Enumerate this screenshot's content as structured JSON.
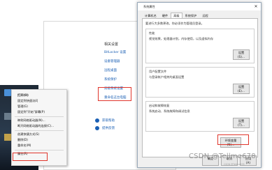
{
  "control_panel": {
    "header": "相关设置",
    "links": [
      "BitLocker 设置",
      "设备管理器",
      "远程桌面",
      "系统保护",
      "高级系统设置",
      "重命名这台电脑"
    ],
    "help": [
      "获取帮助",
      "提供反馈"
    ]
  },
  "context_menu": {
    "items": [
      "打开(O)",
      "固定到快速访问",
      "管理(G)",
      "固定到\"开始\"屏幕(P)",
      "映射网络驱动器(N)...",
      "断开网络驱动器的连接(C)...",
      "创建快捷方式(S)",
      "删除(D)",
      "重命名(M)",
      "属性(R)"
    ]
  },
  "dialog": {
    "title": "系统属性",
    "close": "✕",
    "tabs": [
      "计算机名",
      "硬件",
      "高级",
      "系统保护",
      "远程"
    ],
    "active_tab": "高级",
    "note": "要进行大多数更改，你必须作为管理员登录。",
    "groups": [
      {
        "title": "性能",
        "desc": "视觉效果，处理器计划，内存使用，以及虚拟内存",
        "button": "设置(S)..."
      },
      {
        "title": "用户配置文件",
        "desc": "与登录帐户相关的桌面设置",
        "button": "设置(E)..."
      },
      {
        "title": "启动和故障恢复",
        "desc": "系统启动、系统故障和调试信息",
        "button": "设置(T)..."
      }
    ],
    "env_button": "环境变量(N)...",
    "bottom_buttons": [
      "确定",
      "取消",
      "应用(A)"
    ]
  },
  "watermark": "CSDN @Tellme678",
  "watermark_sub": "CSDN @Tellme678",
  "colors": {
    "highlight": "#e0352b",
    "link": "#1a5fb4"
  }
}
